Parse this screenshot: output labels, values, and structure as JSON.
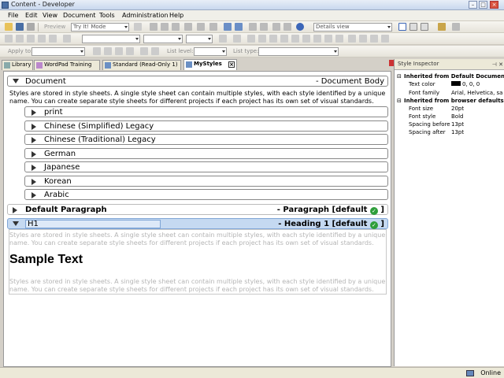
{
  "window": {
    "title": "Content - Developer"
  },
  "menu": [
    "File",
    "Edit",
    "View",
    "Document",
    "Tools",
    "Administration",
    "Help"
  ],
  "toolbar": {
    "preview_label": "Preview",
    "mode_value": "Try It! Mode",
    "view_value": "Details view",
    "apply_to_label": "Apply to:",
    "list_level_label": "List level:",
    "list_type_label": "List type:"
  },
  "tabs": [
    {
      "label": "Library"
    },
    {
      "label": "WordPad Training"
    },
    {
      "label": "Standard (Read-Only 1)"
    },
    {
      "label": "MyStyles"
    }
  ],
  "doc": {
    "document_label": "Document",
    "document_right": "- Document Body",
    "description": "Styles are stored in style sheets. A single style sheet can contain multiple styles, with each style identified by a unique name. You can create separate style sheets for different projects if each project has its own set of visual standards.",
    "sub_items": [
      "print",
      "Chinese (Simplified) Legacy",
      "Chinese (Traditional) Legacy",
      "German",
      "Japanese",
      "Korean",
      "Arabic"
    ],
    "default_paragraph_label": "Default Paragraph",
    "default_paragraph_right": "- Paragraph [default",
    "h1_value": "H1",
    "h1_right": "- Heading 1 [default",
    "bracket_close": "]",
    "check_mark": "✓",
    "sample_text": "Sample Text"
  },
  "inspector": {
    "title": "Style Inspector",
    "section1": "Inherited from Default Document Body",
    "text_color_key": "Text color",
    "text_color_val": "0, 0, 0",
    "font_family_key": "Font family",
    "font_family_val": "Arial, Helvetica, sa",
    "section2": "Inherited from browser defaults",
    "font_size_key": "Font size",
    "font_size_val": "20pt",
    "font_style_key": "Font style",
    "font_style_val": "Bold",
    "spacing_before_key": "Spacing before",
    "spacing_before_val": "13pt",
    "spacing_after_key": "Spacing after",
    "spacing_after_val": "13pt"
  },
  "status": {
    "online": "Online"
  },
  "colors": {
    "accent": "#2e9e3a",
    "selection": "#c5d9f1"
  }
}
